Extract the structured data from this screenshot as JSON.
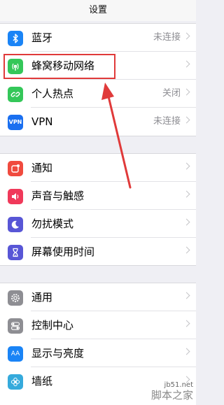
{
  "nav": {
    "title": "设置"
  },
  "group1": [
    {
      "label": "蓝牙",
      "value": "未连接",
      "icon": "bluetooth-icon",
      "color": "#1a84f6"
    },
    {
      "label": "蜂窝移动网络",
      "value": "",
      "icon": "antenna-icon",
      "color": "#34c759"
    },
    {
      "label": "个人热点",
      "value": "关闭",
      "icon": "hotspot-chain-icon",
      "color": "#34c759"
    },
    {
      "label": "VPN",
      "value": "未连接",
      "icon": "vpn-icon",
      "badge": "VPN",
      "color": "#1a6ff0"
    }
  ],
  "group2": [
    {
      "label": "通知",
      "icon": "notifications-icon",
      "color": "#f04a3e"
    },
    {
      "label": "声音与触感",
      "icon": "speaker-icon",
      "color": "#f0395a"
    },
    {
      "label": "勿扰模式",
      "icon": "moon-icon",
      "color": "#5856d6"
    },
    {
      "label": "屏幕使用时间",
      "icon": "hourglass-icon",
      "color": "#5856d6"
    }
  ],
  "group3": [
    {
      "label": "通用",
      "icon": "gear-icon",
      "color": "#8e8e93"
    },
    {
      "label": "控制中心",
      "icon": "toggles-icon",
      "color": "#8e8e93"
    },
    {
      "label": "显示与亮度",
      "icon": "text-size-icon",
      "badge": "AA",
      "color": "#1a84f6"
    },
    {
      "label": "墙纸",
      "icon": "flower-icon",
      "color": "#35aadc"
    }
  ],
  "annotation": {
    "color": "#e03a3a"
  },
  "watermark": {
    "url": "jb51.net",
    "site": "脚本之家"
  }
}
